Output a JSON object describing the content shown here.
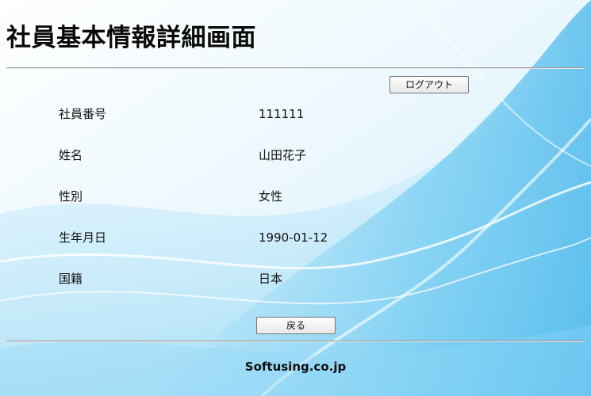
{
  "page": {
    "title": "社員基本情報詳細画面"
  },
  "buttons": {
    "logout_label": "ログアウト",
    "back_label": "戻る"
  },
  "details": [
    {
      "label": "社員番号",
      "value": "111111"
    },
    {
      "label": "姓名",
      "value": "山田花子"
    },
    {
      "label": "性別",
      "value": "女性"
    },
    {
      "label": "生年月日",
      "value": "1990-01-12"
    },
    {
      "label": "国籍",
      "value": "日本"
    }
  ],
  "footer": {
    "text": "Softusing.co.jp"
  },
  "colors": {
    "background_light": "#f4fbff",
    "background_blue": "#7fd0f5",
    "rule": "#9a9a9a"
  }
}
